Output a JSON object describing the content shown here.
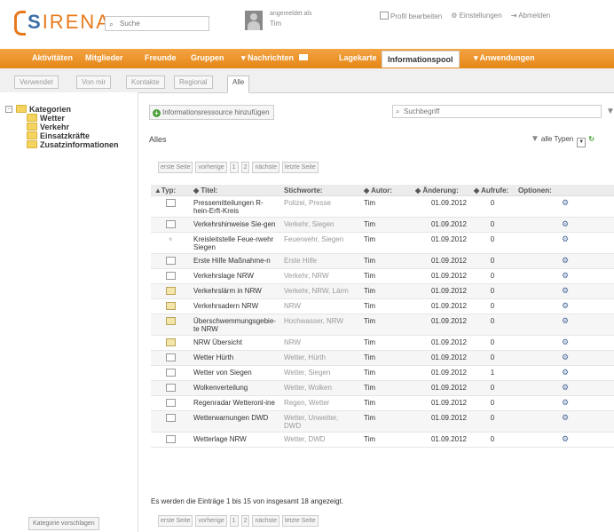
{
  "header": {
    "logo": {
      "s": "S",
      "rest": "IRENA"
    },
    "search_placeholder": "Suche",
    "logged_in_label": "angemeldet als",
    "user": "Tim",
    "links": [
      "Profil bearbeiten",
      "Einstellungen",
      "Abmelden"
    ]
  },
  "nav": [
    "Aktivitäten",
    "Mitglieder",
    "Freunde",
    "Gruppen",
    "▾ Nachrichten",
    "Lagekarte",
    "Informationspool",
    "▾ Anwendungen"
  ],
  "tabs": [
    "Verwendet",
    "Von mir",
    "Kontakte",
    "Regional",
    "Alle"
  ],
  "tree": {
    "root": "Kategorien",
    "children": [
      "Wetter",
      "Verkehr",
      "Einsatzkräfte",
      "Zusatzinformationen"
    ]
  },
  "suggest_category": "Kategorie vorschlagen",
  "add_resource": "Informationsressource hinzufügen",
  "search_placeholder": "Suchbegriff",
  "section_title": "Alles",
  "type_filter": "alle Typen",
  "pager": [
    "erste Seite",
    "vorherige",
    "1",
    "2",
    "nächste",
    "letzte Seite"
  ],
  "columns": [
    "▲Typ:",
    "◆ Titel:",
    "Stichworte:",
    "◆ Autor:",
    "◆ Änderung:",
    "◆ Aufrufe:",
    "Optionen:"
  ],
  "rows": [
    {
      "type": "doc",
      "title": "Pressemitteilungen R-hein-Erft-Kreis",
      "tags": "Polizei, Presse",
      "author": "Tim",
      "date": "01.09.2012",
      "calls": "0"
    },
    {
      "type": "doc",
      "title": "Verkehrshinweise Sie-gen",
      "tags": "Verkehr, Siegen",
      "author": "Tim",
      "date": "01.09.2012",
      "calls": "0"
    },
    {
      "type": "trophy",
      "title": "Kreisleitstelle Feue-rwehr Siegen",
      "tags": "Feuerwehr, Siegen",
      "author": "Tim",
      "date": "01.09.2012",
      "calls": "0"
    },
    {
      "type": "doc",
      "title": "Erste Hilfe Maßnahme-n",
      "tags": "Erste Hilfe",
      "author": "Tim",
      "date": "01.09.2012",
      "calls": "0"
    },
    {
      "type": "doc",
      "title": "Verkehrslage NRW",
      "tags": "Verkehr, NRW",
      "author": "Tim",
      "date": "01.09.2012",
      "calls": "0"
    },
    {
      "type": "ydoc",
      "title": "Verkehrslärm in NRW",
      "tags": "Verkehr, NRW, Lärm",
      "author": "Tim",
      "date": "01.09.2012",
      "calls": "0"
    },
    {
      "type": "ydoc",
      "title": "Verkehrsadern NRW",
      "tags": "NRW",
      "author": "Tim",
      "date": "01.09.2012",
      "calls": "0"
    },
    {
      "type": "ydoc",
      "title": "Überschwemmungsgebie-te NRW",
      "tags": "Hochwasser, NRW",
      "author": "Tim",
      "date": "01.09.2012",
      "calls": "0"
    },
    {
      "type": "ydoc",
      "title": "NRW Übersicht",
      "tags": "NRW",
      "author": "Tim",
      "date": "01.09.2012",
      "calls": "0"
    },
    {
      "type": "doc",
      "title": "Wetter Hürth",
      "tags": "Wetter, Hürth",
      "author": "Tim",
      "date": "01.09.2012",
      "calls": "0"
    },
    {
      "type": "doc",
      "title": "Wetter von Siegen",
      "tags": "Wetter, Siegen",
      "author": "Tim",
      "date": "01.09.2012",
      "calls": "1"
    },
    {
      "type": "doc",
      "title": "Wolkenverteilung",
      "tags": "Wetter, Wolken",
      "author": "Tim",
      "date": "01.09.2012",
      "calls": "0"
    },
    {
      "type": "doc",
      "title": "Regenradar Wetteronl-ine",
      "tags": "Regen, Wetter",
      "author": "Tim",
      "date": "01.09.2012",
      "calls": "0"
    },
    {
      "type": "doc",
      "title": "Wetterwarnungen DWD",
      "tags": "Wetter, Unwetter, DWD",
      "author": "Tim",
      "date": "01.09.2012",
      "calls": "0"
    },
    {
      "type": "doc",
      "title": "Wetterlage NRW",
      "tags": "Wetter, DWD",
      "author": "Tim",
      "date": "01.09.2012",
      "calls": "0"
    }
  ],
  "footer_text": "Es werden die Einträge 1 bis 15 von insgesamt 18 angezeigt."
}
